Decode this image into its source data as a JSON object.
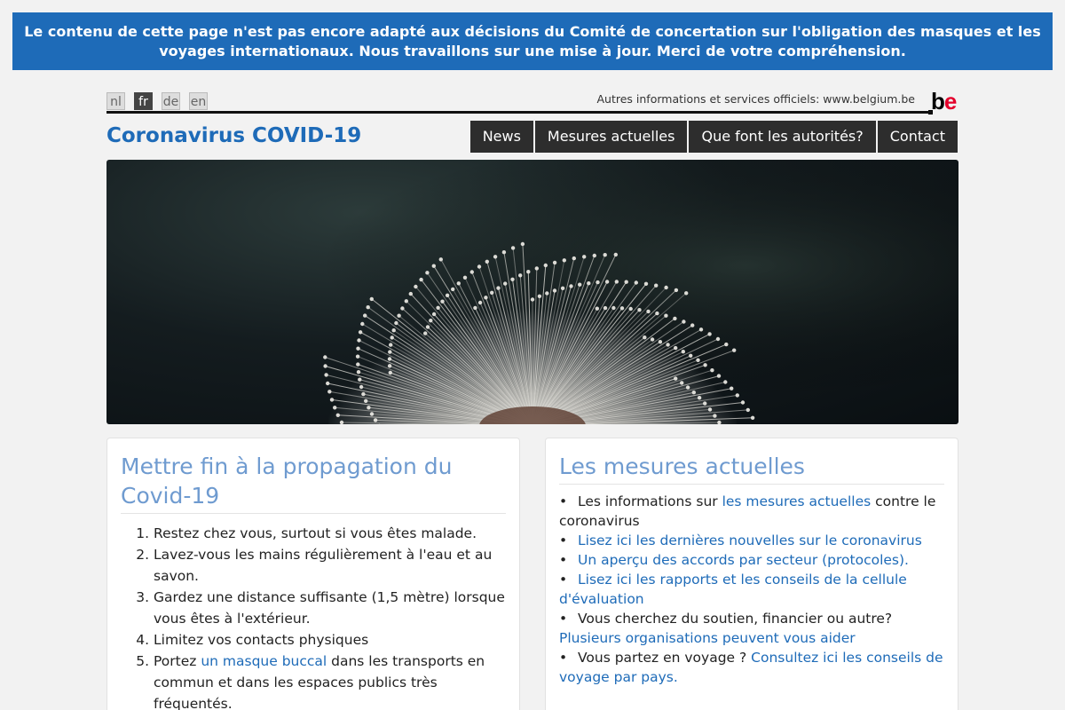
{
  "banner": {
    "text": "Le contenu de cette page n'est pas encore adapté aux décisions du Comité de concertation sur l'obligation des masques et les voyages internationaux. Nous travaillons sur une mise à jour. Merci de votre compréhension."
  },
  "header": {
    "languages": [
      "nl",
      "fr",
      "de",
      "en"
    ],
    "active_language": "fr",
    "official_text": "Autres informations et services officiels: www.belgium.be",
    "logo": ".be",
    "site_title": "Coronavirus COVID-19",
    "nav": [
      "News",
      "Mesures actuelles",
      "Que font les autorités?",
      "Contact"
    ]
  },
  "hero": {
    "image": "dandelion-photo"
  },
  "card_left": {
    "title": "Mettre fin à la propagation du Covid-19",
    "items": [
      {
        "text": "Restez chez vous, surtout si vous êtes malade."
      },
      {
        "text": "Lavez-vous les mains régulièrement à l'eau et au savon."
      },
      {
        "text": "Gardez une distance suffisante (1,5 mètre) lorsque vous êtes à l'extérieur."
      },
      {
        "text": "Limitez vos contacts physiques"
      },
      {
        "before": "Portez ",
        "link": "un masque buccal",
        "after": " dans les transports en commun et dans les espaces publics très fréquentés."
      }
    ]
  },
  "card_right": {
    "title": "Les mesures actuelles",
    "items": [
      {
        "before": "Les informations sur ",
        "link": "les mesures actuelles",
        "after": " contre le coronavirus"
      },
      {
        "link": "Lisez ici les dernières nouvelles sur le coronavirus"
      },
      {
        "link": "Un aperçu des accords par secteur (protocoles)."
      },
      {
        "link": "Lisez ici les rapports et les conseils de la cellule d'évaluation"
      },
      {
        "before": "Vous cherchez du soutien, financier ou autre? ",
        "link": "Plusieurs organisations peuvent vous aider"
      },
      {
        "before": "Vous partez en voyage ? ",
        "link": "Consultez ici les conseils de voyage par pays."
      }
    ]
  },
  "colors": {
    "brand_blue": "#1e6bb8",
    "nav_bg": "#2d2d2d",
    "card_title": "#6f9bd0",
    "be_red": "#e4002b"
  }
}
